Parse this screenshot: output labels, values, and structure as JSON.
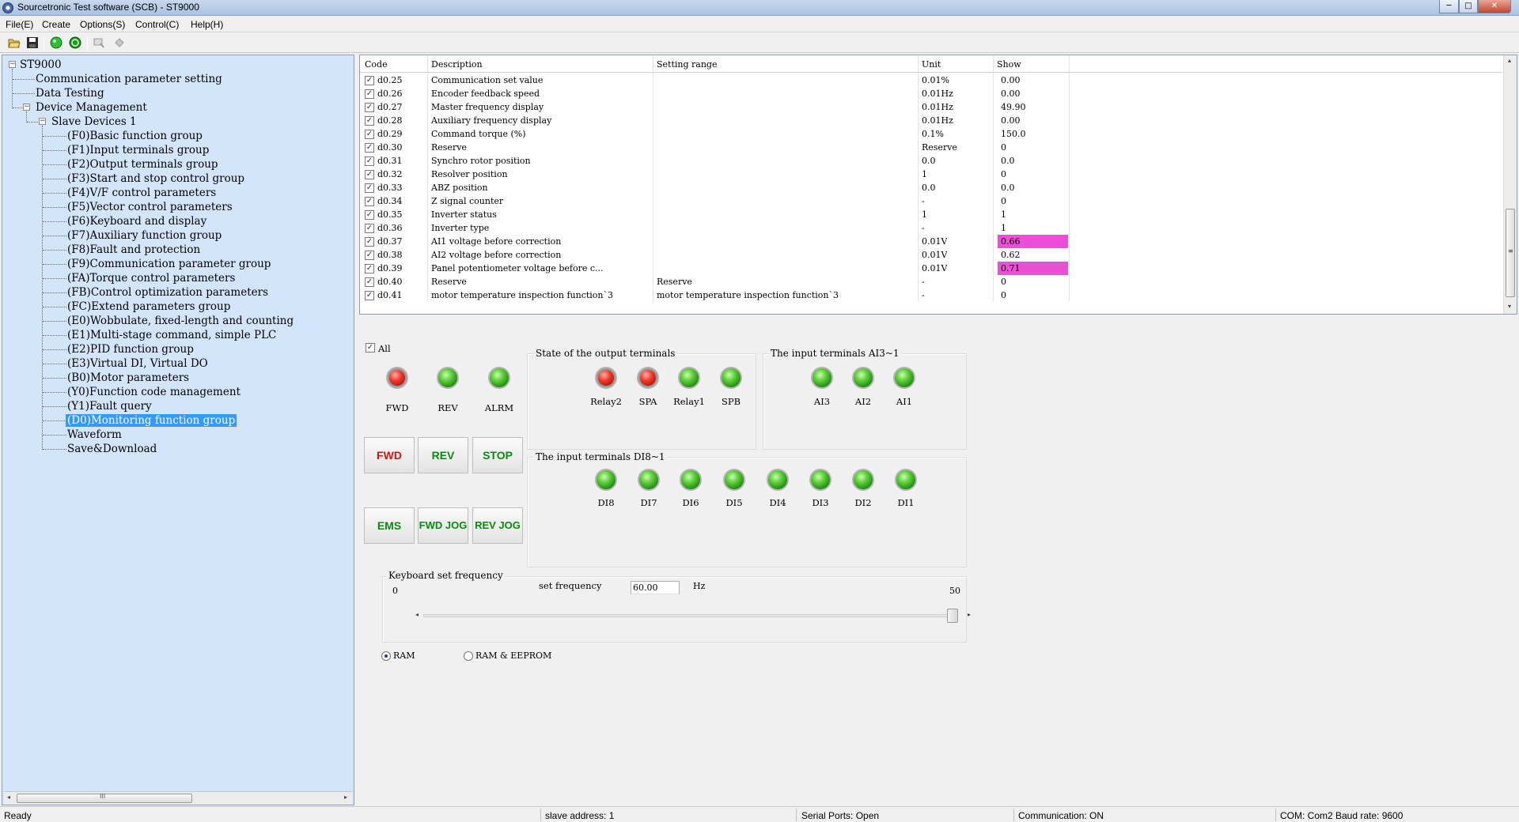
{
  "window": {
    "title": "Sourcetronic Test software (SCB) - ST9000",
    "min": "─",
    "max": "□",
    "close": "✕"
  },
  "menu": [
    "File(E)",
    "Create",
    "Options(S)",
    "Control(C)",
    "Help(H)"
  ],
  "toolbar": [
    "open-folder-icon",
    "save-icon",
    "connect-icon",
    "disconnect-icon",
    "monitor-icon",
    "upload-icon"
  ],
  "tree": {
    "root": "ST9000",
    "items": [
      "Communication parameter setting",
      "Data Testing",
      "Device Management"
    ],
    "slave": "Slave Devices 1",
    "groups": [
      "(F0)Basic function group",
      "(F1)Input terminals group",
      "(F2)Output terminals group",
      "(F3)Start and stop control group",
      "(F4)V/F control parameters",
      "(F5)Vector control parameters",
      "(F6)Keyboard and display",
      "(F7)Auxiliary function group",
      "(F8)Fault and protection",
      "(F9)Communication parameter group",
      "(FA)Torque control parameters",
      "(FB)Control optimization parameters",
      "(FC)Extend parameters group",
      "(E0)Wobbulate, fixed-length and counting",
      "(E1)Multi-stage command, simple PLC",
      "(E2)PID function group",
      "(E3)Virtual DI, Virtual DO",
      "(B0)Motor parameters",
      "(Y0)Function code management",
      "(Y1)Fault query",
      "(D0)Monitoring function group"
    ],
    "selected_index": 20,
    "after": [
      "Waveform",
      "Save&Download"
    ],
    "expand_sign": "−",
    "scroll_grip": "III",
    "scroll_left": "◂",
    "scroll_right": "▸"
  },
  "grid": {
    "headers": [
      "Code",
      "Description",
      "Setting range",
      "Unit",
      "Show"
    ],
    "check_mark": "✓",
    "rows": [
      {
        "code": "d0.25",
        "desc": "Communication set value",
        "range": "",
        "unit": "0.01%",
        "show": "0.00",
        "hl": false
      },
      {
        "code": "d0.26",
        "desc": "Encoder feedback speed",
        "range": "",
        "unit": "0.01Hz",
        "show": "0.00",
        "hl": false
      },
      {
        "code": "d0.27",
        "desc": "Master frequency display",
        "range": "",
        "unit": "0.01Hz",
        "show": "49.90",
        "hl": false
      },
      {
        "code": "d0.28",
        "desc": "Auxiliary frequency display",
        "range": "",
        "unit": "0.01Hz",
        "show": "0.00",
        "hl": false
      },
      {
        "code": "d0.29",
        "desc": "Command torque (%)",
        "range": "",
        "unit": "0.1%",
        "show": "150.0",
        "hl": false
      },
      {
        "code": "d0.30",
        "desc": "Reserve",
        "range": "",
        "unit": "Reserve",
        "show": "0",
        "hl": false
      },
      {
        "code": "d0.31",
        "desc": "Synchro rotor position",
        "range": "",
        "unit": "0.0",
        "show": "0.0",
        "hl": false
      },
      {
        "code": "d0.32",
        "desc": "Resolver position",
        "range": "",
        "unit": "1",
        "show": "0",
        "hl": false
      },
      {
        "code": "d0.33",
        "desc": "ABZ position",
        "range": "",
        "unit": "0.0",
        "show": "0.0",
        "hl": false
      },
      {
        "code": "d0.34",
        "desc": "Z signal counter",
        "range": "",
        "unit": "-",
        "show": "0",
        "hl": false
      },
      {
        "code": "d0.35",
        "desc": "Inverter status",
        "range": "",
        "unit": "1",
        "show": "1",
        "hl": false
      },
      {
        "code": "d0.36",
        "desc": "Inverter type",
        "range": "",
        "unit": "-",
        "show": "1",
        "hl": false
      },
      {
        "code": "d0.37",
        "desc": "AI1 voltage before correction",
        "range": "",
        "unit": "0.01V",
        "show": "0.66",
        "hl": true
      },
      {
        "code": "d0.38",
        "desc": "AI2 voltage before correction",
        "range": "",
        "unit": "0.01V",
        "show": "0.62",
        "hl": false
      },
      {
        "code": "d0.39",
        "desc": "Panel potentiometer voltage before c...",
        "range": "",
        "unit": "0.01V",
        "show": "0.71",
        "hl": true
      },
      {
        "code": "d0.40",
        "desc": "Reserve",
        "range": "Reserve",
        "unit": "-",
        "show": "0",
        "hl": false
      },
      {
        "code": "d0.41",
        "desc": "motor temperature inspection function`3",
        "range": "motor temperature inspection function`3",
        "unit": "-",
        "show": "0",
        "hl": false
      }
    ],
    "scroll_up": "▴",
    "scroll_down": "▾",
    "scroll_grip": "≡"
  },
  "control": {
    "all_label": "All",
    "status_leds": [
      {
        "label": "FWD",
        "color": "red"
      },
      {
        "label": "REV",
        "color": "green"
      },
      {
        "label": "ALRM",
        "color": "green"
      }
    ],
    "buttons": [
      "FWD",
      "REV",
      "STOP",
      "EMS",
      "FWD JOG",
      "REV JOG"
    ],
    "output_title": "State of the output terminals",
    "outputs": [
      {
        "label": "Relay2",
        "color": "red"
      },
      {
        "label": "SPA",
        "color": "red"
      },
      {
        "label": "Relay1",
        "color": "green"
      },
      {
        "label": "SPB",
        "color": "green"
      }
    ],
    "ai_title": "The input terminals AI3~1",
    "ai": [
      {
        "label": "AI3",
        "color": "green"
      },
      {
        "label": "AI2",
        "color": "green"
      },
      {
        "label": "AI1",
        "color": "green"
      }
    ],
    "di_title": "The input terminals DI8~1",
    "di": [
      {
        "label": "DI8",
        "color": "green"
      },
      {
        "label": "DI7",
        "color": "green"
      },
      {
        "label": "DI6",
        "color": "green"
      },
      {
        "label": "DI5",
        "color": "green"
      },
      {
        "label": "DI4",
        "color": "green"
      },
      {
        "label": "DI3",
        "color": "green"
      },
      {
        "label": "DI2",
        "color": "green"
      },
      {
        "label": "DI1",
        "color": "green"
      }
    ]
  },
  "keyboard": {
    "title": "Keyboard set frequency",
    "min": "0",
    "max": "50",
    "set_label": "set frequency",
    "value": "60.00",
    "unit": "Hz",
    "slider_level": 1.0,
    "left_arrow": "◂",
    "right_arrow": "▸"
  },
  "storage": {
    "options": [
      "RAM",
      "RAM & EEPROM"
    ],
    "selected": "RAM"
  },
  "status": {
    "ready": "Ready",
    "slave": "slave address: 1",
    "serial": "Serial Ports: Open",
    "comm": "Communication: ON",
    "com": "COM: Com2 Baud rate: 9600"
  },
  "colors": {
    "highlight": "#ec4fd6",
    "selection": "#3399ff",
    "tree_bg": "#d2e5fa"
  }
}
